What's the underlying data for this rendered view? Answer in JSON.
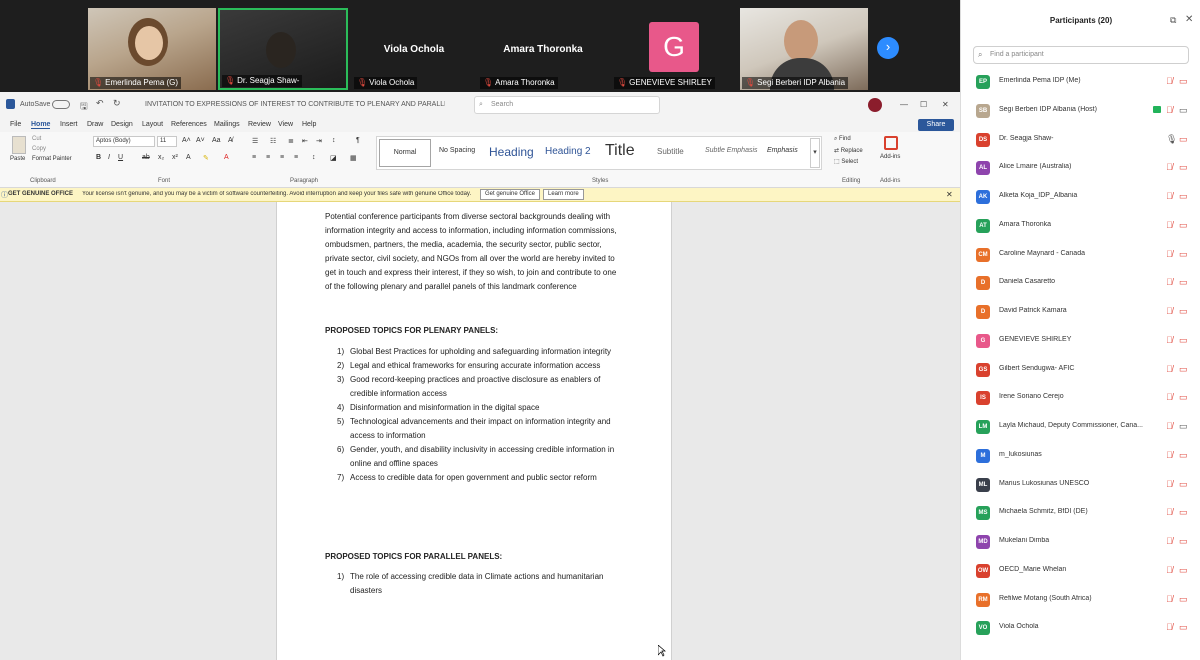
{
  "video_strip": {
    "tiles": [
      {
        "label": "Emerlinda Pema (G)"
      },
      {
        "label": "Dr. Seagja Shaw-"
      },
      {
        "label": "Viola Ochola",
        "display_name": "Viola Ochola"
      },
      {
        "label": "Amara Thoronka",
        "display_name": "Amara Thoronka"
      },
      {
        "label": "GENEVIEVE SHIRLEY",
        "avatar_letter": "G",
        "avatar_color": "#e8588a"
      },
      {
        "label": "Segi Berberi IDP Albania"
      }
    ],
    "next_icon": "chevron-right-icon"
  },
  "word": {
    "autosave": "AutoSave",
    "doc_title": "INVITATION TO EXPRESSIONS OF INTEREST TO CONTRIBUTE TO PLENARY AND PARALLEL PANELS • Saved",
    "search_placeholder": "Search",
    "menu": [
      "File",
      "Home",
      "Insert",
      "Draw",
      "Design",
      "Layout",
      "References",
      "Mailings",
      "Review",
      "View",
      "Help"
    ],
    "active_menu": "Home",
    "share_label": "Share",
    "ribbon": {
      "paste": "Paste",
      "cut": "Cut",
      "copy": "Copy",
      "format_painter": "Format Painter",
      "font_name": "Aptos (Body)",
      "font_size": "11",
      "groups": [
        "Clipboard",
        "Font",
        "Paragraph",
        "Styles",
        "Editing",
        "Add-ins"
      ],
      "styles": [
        "Normal",
        "No Spacing",
        "Heading",
        "Heading 2",
        "Title",
        "Subtitle",
        "Subtle Emphasis",
        "Emphasis"
      ],
      "find": "Find",
      "replace": "Replace",
      "select": "Select",
      "addins": "Add-ins"
    },
    "notice": {
      "label": "GET GENUINE OFFICE",
      "message": "Your license isn't genuine, and you may be a victim of software counterfeiting. Avoid interruption and keep your files safe with genuine Office today.",
      "button1": "Get genuine Office",
      "button2": "Learn more"
    },
    "document": {
      "intro": "Potential conference  participants from diverse sectoral backgrounds dealing with information integrity and access to information, including information commissions, ombudsmen, partners, the media, academia, the security sector, public sector, private sector, civil society, and NGOs from all over  the world are hereby invited to get in touch and express their interest, if they so wish, to join and contribute to one of the following plenary and parallel panels of this landmark conference",
      "plenary_heading": "PROPOSED TOPICS FOR PLENARY PANELS:",
      "plenary_items": [
        "Global Best Practices for upholding and safeguarding information integrity",
        "Legal and ethical frameworks for ensuring accurate information access",
        "Good record-keeping practices and proactive disclosure as enablers of credible information access",
        "Disinformation and misinformation in the digital space",
        "Technological advancements and their impact on information integrity and access to information",
        "Gender, youth, and disability inclusivity in accessing credible information in online and offline spaces",
        "Access to credible data for open government and public sector reform"
      ],
      "parallel_heading": "PROPOSED TOPICS FOR PARALLEL PANELS:",
      "parallel_items": [
        "The role of accessing credible data in Climate actions and humanitarian disasters"
      ]
    }
  },
  "participants": {
    "title": "Participants (20)",
    "find_placeholder": "Find a participant",
    "list": [
      {
        "initials": "EP",
        "color": "#27a15a",
        "name": "Emerlinda Pema IDP (Me)",
        "mic": "muted",
        "cam": "off"
      },
      {
        "initials": "SB",
        "color": "#b8a78f",
        "name": "Segi Berberi IDP Albania (Host)",
        "mic": "muted",
        "cam": "on",
        "sharing": true
      },
      {
        "initials": "DS",
        "color": "#d9412e",
        "name": "Dr. Seagja Shaw-",
        "mic": "on",
        "cam": "off"
      },
      {
        "initials": "AL",
        "color": "#8e44ad",
        "name": "Alice Lmaire (Australia)",
        "mic": "muted",
        "cam": "off"
      },
      {
        "initials": "AK",
        "color": "#2d6fdb",
        "name": "Alketa Koja_IDP_Albania",
        "mic": "muted",
        "cam": "off"
      },
      {
        "initials": "AT",
        "color": "#27a15a",
        "name": "Amara Thoronka",
        "mic": "muted",
        "cam": "off"
      },
      {
        "initials": "CM",
        "color": "#e8702a",
        "name": "Caroline Maynard - Canada",
        "mic": "muted",
        "cam": "off"
      },
      {
        "initials": "D",
        "color": "#e8702a",
        "name": "Daniela Casaretto",
        "mic": "muted",
        "cam": "off"
      },
      {
        "initials": "D",
        "color": "#e8702a",
        "name": "David Patrick Kamara",
        "mic": "muted",
        "cam": "off"
      },
      {
        "initials": "G",
        "color": "#e8588a",
        "name": "GENEVIEVE SHIRLEY",
        "mic": "muted",
        "cam": "off"
      },
      {
        "initials": "GS",
        "color": "#d9412e",
        "name": "Gilbert Sendugwa- AFIC",
        "mic": "muted",
        "cam": "off"
      },
      {
        "initials": "IS",
        "color": "#d9412e",
        "name": "Irene Soriano Cerejo",
        "mic": "muted",
        "cam": "off"
      },
      {
        "initials": "LM",
        "color": "#27a15a",
        "name": "Layla Michaud, Deputy Commissioner, Cana...",
        "mic": "muted",
        "cam": "on"
      },
      {
        "initials": "M",
        "color": "#2d6fdb",
        "name": "m_lukosiunas",
        "mic": "muted",
        "cam": "off"
      },
      {
        "initials": "ML",
        "color": "#3a3f4b",
        "name": "Marius Lukosiunas UNESCO",
        "mic": "muted",
        "cam": "off"
      },
      {
        "initials": "MS",
        "color": "#27a15a",
        "name": "Michaela Schmitz, BfDI (DE)",
        "mic": "muted",
        "cam": "off"
      },
      {
        "initials": "MD",
        "color": "#8e44ad",
        "name": "Mukelani Dimba",
        "mic": "muted",
        "cam": "off"
      },
      {
        "initials": "OW",
        "color": "#d9412e",
        "name": "OECD_Marie Whelan",
        "mic": "muted",
        "cam": "off"
      },
      {
        "initials": "RM",
        "color": "#e8702a",
        "name": "Refilwe Motang (South Africa)",
        "mic": "muted",
        "cam": "off"
      },
      {
        "initials": "VO",
        "color": "#27a15a",
        "name": "Viola Ochola",
        "mic": "muted",
        "cam": "off"
      }
    ]
  }
}
